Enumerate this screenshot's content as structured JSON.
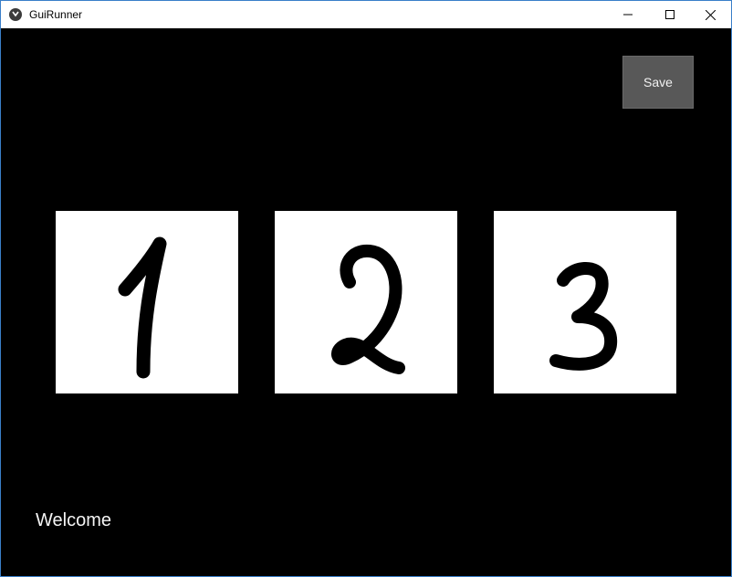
{
  "window": {
    "title": "GuiRunner",
    "controls": {
      "minimize_icon": "minimize-icon",
      "maximize_icon": "maximize-icon",
      "close_icon": "close-icon"
    }
  },
  "toolbar": {
    "save_label": "Save"
  },
  "digits": [
    {
      "label": "1"
    },
    {
      "label": "2"
    },
    {
      "label": "3"
    }
  ],
  "status": {
    "message": "Welcome"
  },
  "colors": {
    "canvas_bg": "#000000",
    "card_bg": "#ffffff",
    "stroke": "#000000",
    "button_bg": "#585858"
  }
}
